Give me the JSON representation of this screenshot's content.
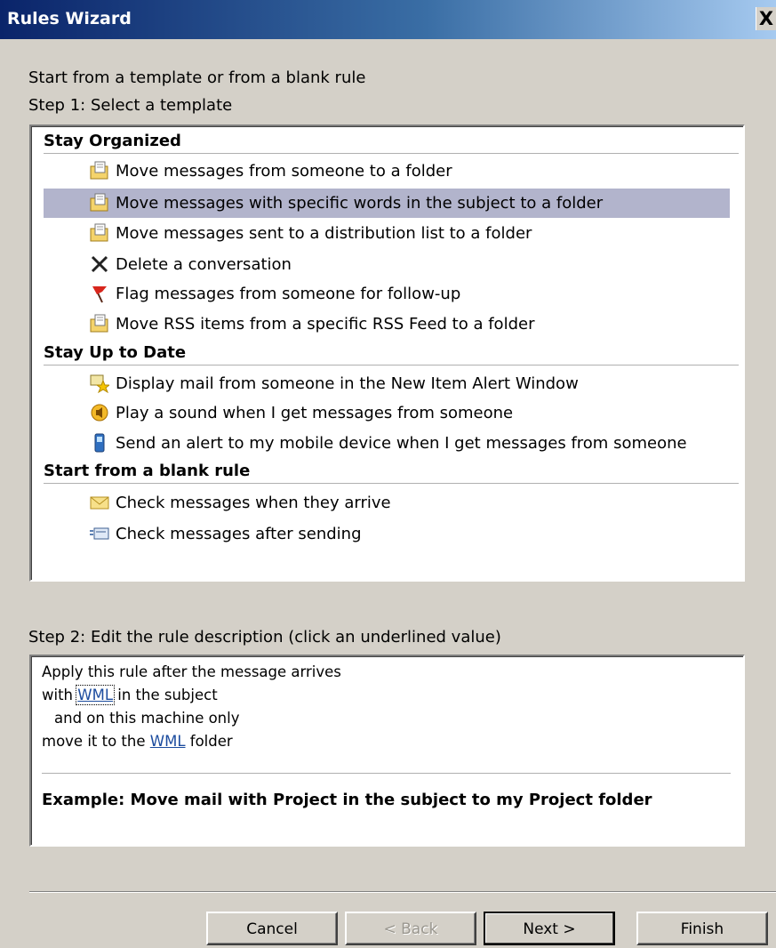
{
  "window": {
    "title": "Rules Wizard",
    "close_glyph": "X"
  },
  "intro": "Start from a template or from a blank rule",
  "step1": {
    "label": "Step 1: Select a template",
    "groups": [
      {
        "header": "Stay Organized",
        "items": [
          {
            "label": "Move messages from someone to a folder",
            "icon": "move-to-folder-icon"
          },
          {
            "label": "Move messages with specific words in the subject to a folder",
            "icon": "move-to-folder-icon",
            "selected": true
          },
          {
            "label": "Move messages sent to a distribution list to a folder",
            "icon": "move-to-folder-icon"
          },
          {
            "label": "Delete a conversation",
            "icon": "delete-x-icon"
          },
          {
            "label": "Flag messages from someone for follow-up",
            "icon": "flag-icon"
          },
          {
            "label": "Move RSS items from a specific RSS Feed to a folder",
            "icon": "move-to-folder-icon"
          }
        ]
      },
      {
        "header": "Stay Up to Date",
        "items": [
          {
            "label": "Display mail from someone in the New Item Alert Window",
            "icon": "alert-window-icon"
          },
          {
            "label": "Play a sound when I get messages from someone",
            "icon": "speaker-icon"
          },
          {
            "label": "Send an alert to my mobile device when I get messages from someone",
            "icon": "mobile-device-icon"
          }
        ]
      },
      {
        "header": "Start from a blank rule",
        "items": [
          {
            "label": "Check messages when they arrive",
            "icon": "envelope-icon"
          },
          {
            "label": "Check messages after sending",
            "icon": "sent-message-icon"
          }
        ]
      }
    ]
  },
  "step2": {
    "label": "Step 2: Edit the rule description (click an underlined value)",
    "line1": "Apply this rule after the message arrives",
    "line2_prefix": "with ",
    "line2_link": "WML",
    "line2_suffix": " in the subject",
    "line3": "and on this machine only",
    "line4_prefix": "move it to the ",
    "line4_link": "WML",
    "line4_suffix": " folder",
    "example": "Example: Move mail with Project in the subject to my Project folder"
  },
  "buttons": {
    "cancel": "Cancel",
    "back": "< Back",
    "next": "Next >",
    "finish": "Finish"
  },
  "colors": {
    "selection": "#b2b4cc",
    "dialog_face": "#d4d0c8",
    "link": "#1b4b9e"
  }
}
